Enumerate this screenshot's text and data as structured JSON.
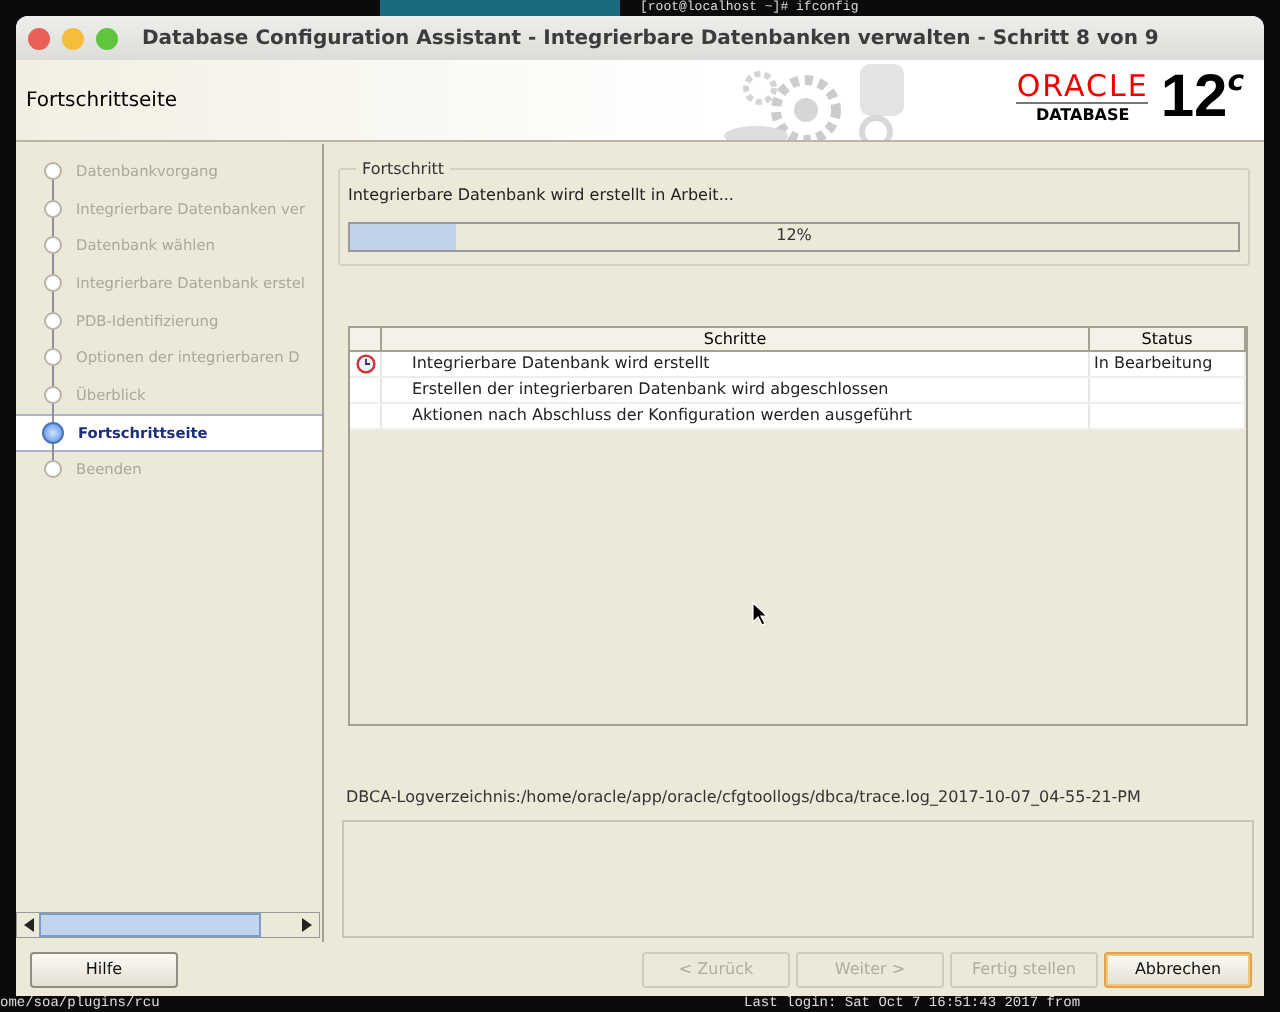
{
  "background": {
    "terminal_top": "[root@localhost ~]# ifconfig",
    "terminal_bottom_left": "ome/soa/plugins/rcu",
    "terminal_bottom_right": "Last login: Sat Oct  7 16:51:43 2017 from"
  },
  "window": {
    "title": "Database Configuration Assistant - Integrierbare Datenbanken verwalten - Schritt 8 von 9"
  },
  "header": {
    "page_title": "Fortschrittseite",
    "brand": "ORACLE",
    "product": "DATABASE",
    "version": "12",
    "version_suffix": "c"
  },
  "sidebar": {
    "items": [
      {
        "label": "Datenbankvorgang",
        "selected": false
      },
      {
        "label": "Integrierbare Datenbanken ver",
        "selected": false
      },
      {
        "label": "Datenbank wählen",
        "selected": false
      },
      {
        "label": "Integrierbare Datenbank erstel",
        "selected": false
      },
      {
        "label": "PDB-Identifizierung",
        "selected": false
      },
      {
        "label": "Optionen der integrierbaren D",
        "selected": false
      },
      {
        "label": "Überblick",
        "selected": false
      },
      {
        "label": "Fortschrittseite",
        "selected": true
      },
      {
        "label": "Beenden",
        "selected": false
      }
    ]
  },
  "progress": {
    "group_label": "Fortschritt",
    "message": "Integrierbare Datenbank wird erstellt in Arbeit...",
    "level": 0.12,
    "reading": "12%"
  },
  "table": {
    "columns": [
      "Schritte",
      "Status"
    ],
    "rows": [
      {
        "kind": "running",
        "step": "Integrierbare Datenbank wird erstellt",
        "status": "In Bearbeitung"
      },
      {
        "kind": "pending",
        "step": "Erstellen der integrierbaren Datenbank wird abgeschlossen"
      },
      {
        "kind": "pending",
        "step": "Aktionen nach Abschluss der Konfiguration werden ausgeführt"
      }
    ]
  },
  "log": {
    "label": "DBCA-Logverzeichnis:/home/oracle/app/oracle/cfgtoollogs/dbca/trace.log_2017-10-07_04-55-21-PM"
  },
  "buttons": [
    {
      "label": "Hilfe",
      "disabled": false,
      "focused": false
    },
    {
      "label": "< Zurück",
      "disabled": true,
      "focused": false
    },
    {
      "label": "Weiter >",
      "disabled": true,
      "focused": false
    },
    {
      "label": "Fertig stellen",
      "disabled": true,
      "focused": false
    },
    {
      "label": "Abbrechen",
      "disabled": false,
      "focused": true
    }
  ]
}
